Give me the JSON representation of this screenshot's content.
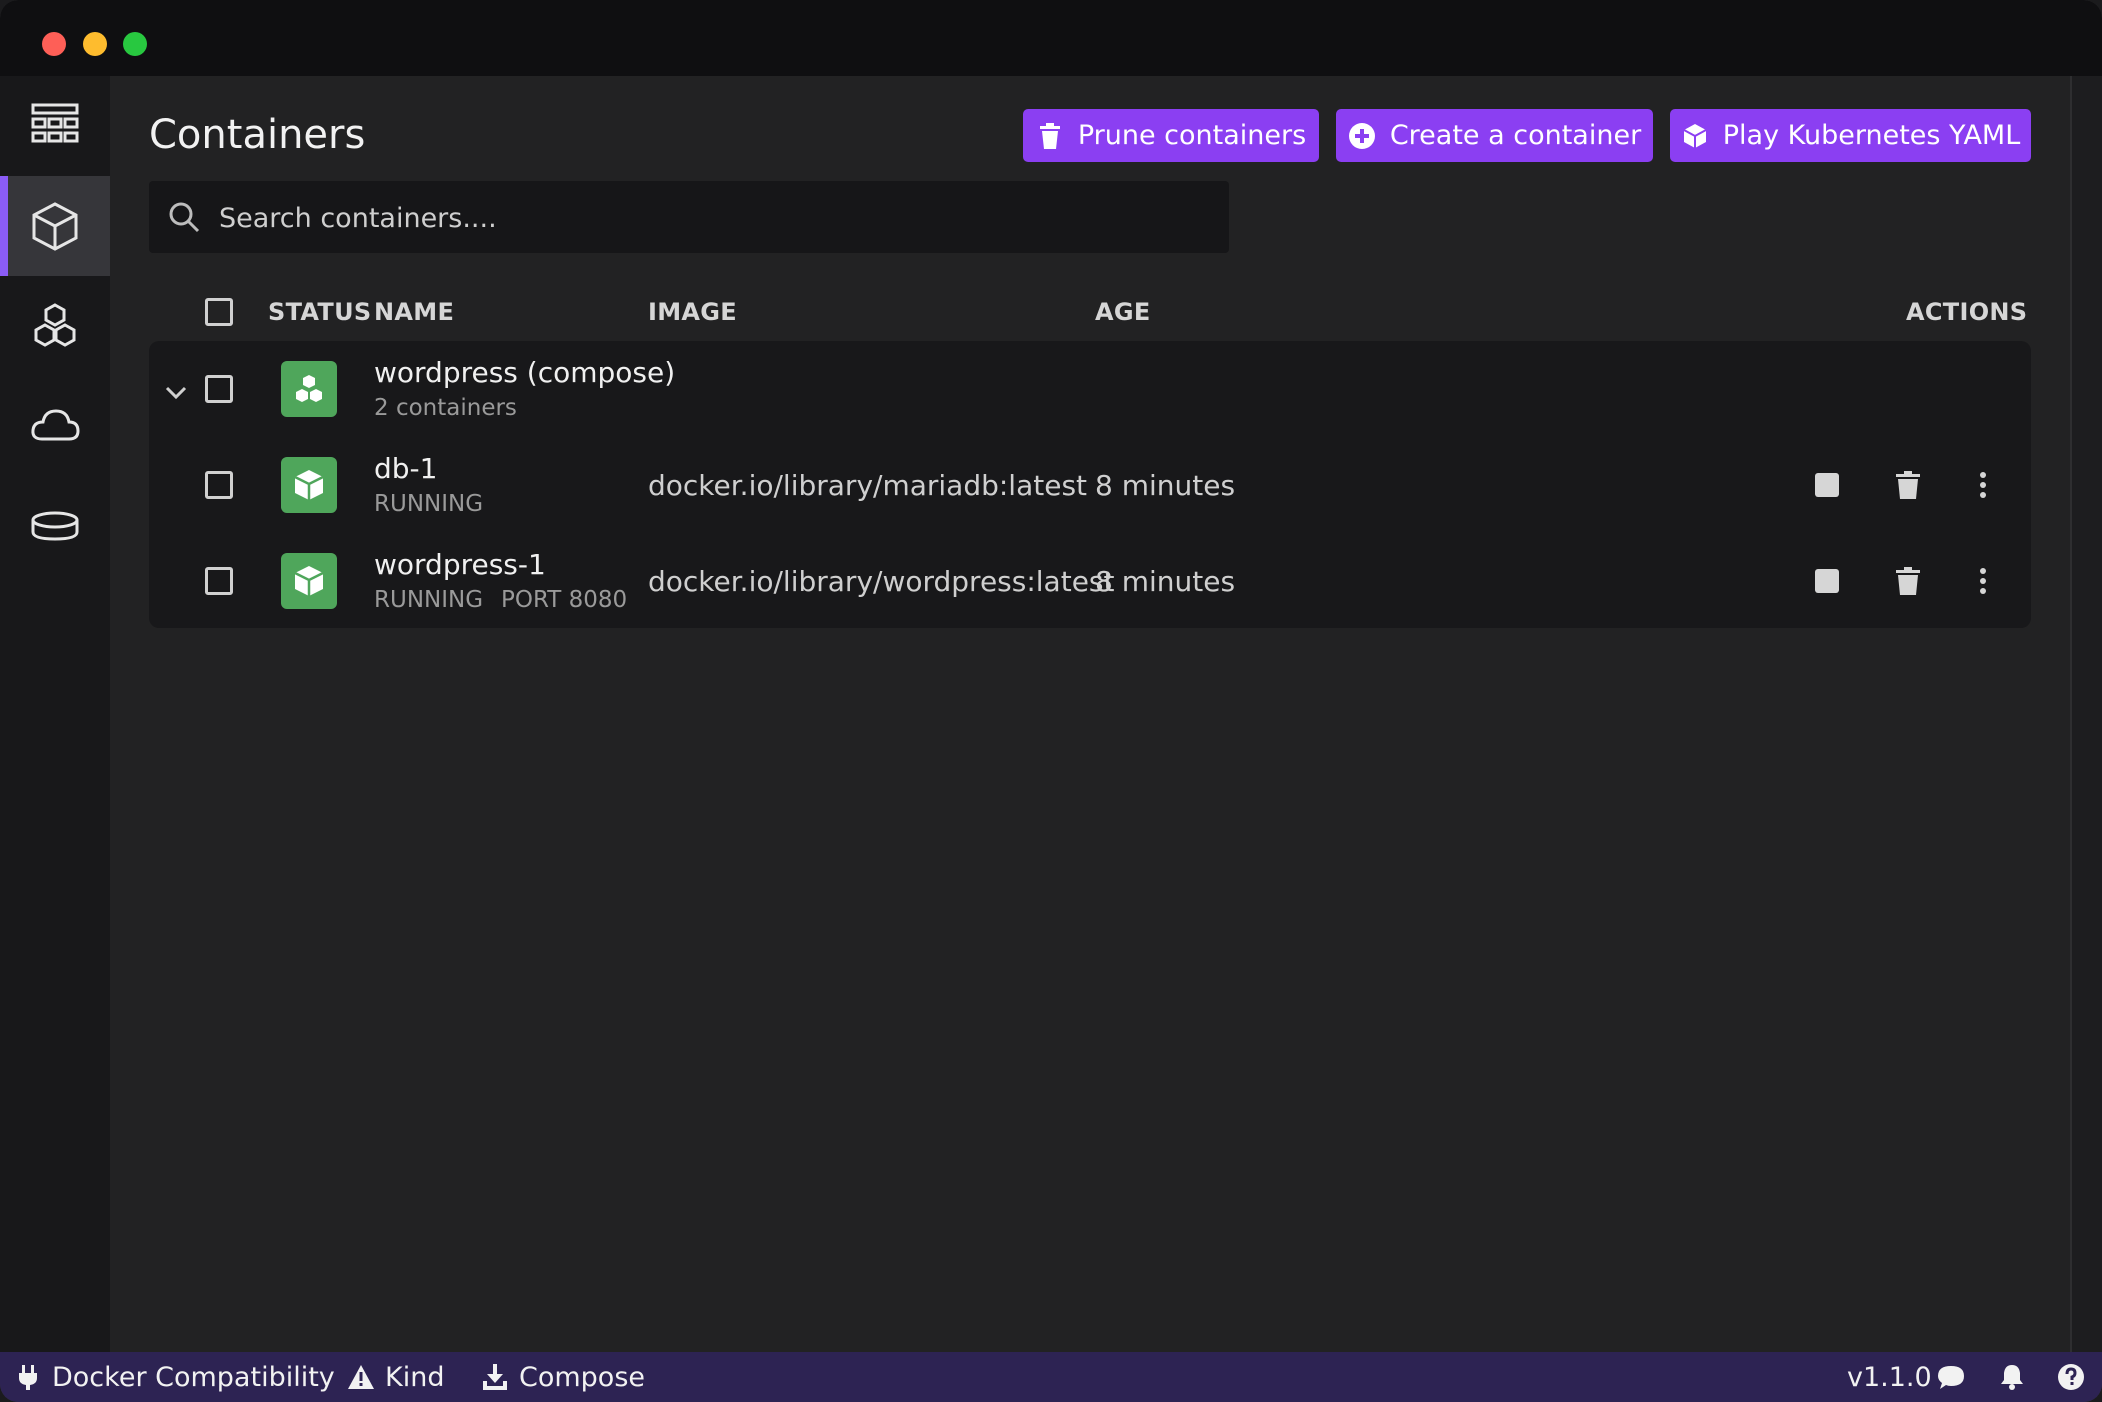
{
  "window": {
    "title": "Containers"
  },
  "sidebar": {
    "items": [
      {
        "name": "dashboard",
        "icon": "dashboard-icon",
        "active": false
      },
      {
        "name": "containers",
        "icon": "container-cube-icon",
        "active": true
      },
      {
        "name": "pods",
        "icon": "pods-cubes-icon",
        "active": false
      },
      {
        "name": "images",
        "icon": "cloud-icon",
        "active": false
      },
      {
        "name": "volumes",
        "icon": "volume-disk-icon",
        "active": false
      }
    ],
    "settings_icon": "gear-icon"
  },
  "header": {
    "title": "Containers",
    "buttons": {
      "prune": "Prune containers",
      "create": "Create a container",
      "play": "Play Kubernetes YAML"
    }
  },
  "search": {
    "placeholder": "Search containers...."
  },
  "table": {
    "columns": {
      "status": "STATUS",
      "name": "NAME",
      "image": "IMAGE",
      "age": "AGE",
      "actions": "ACTIONS"
    },
    "group": {
      "name": "wordpress (compose)",
      "subtitle": "2 containers"
    },
    "rows": [
      {
        "name": "db-1",
        "state": "RUNNING",
        "port": "",
        "image": "docker.io/library/mariadb:latest",
        "age": "8 minutes"
      },
      {
        "name": "wordpress-1",
        "state": "RUNNING",
        "port": "PORT 8080",
        "image": "docker.io/library/wordpress:latest",
        "age": "8 minutes"
      }
    ]
  },
  "statusbar": {
    "docker": "Docker Compatibility",
    "kind": "Kind",
    "compose": "Compose",
    "version": "v1.1.0"
  },
  "colors": {
    "accent": "#8b3ff2",
    "running": "#4fa65b",
    "statusbar": "#2d2353"
  }
}
